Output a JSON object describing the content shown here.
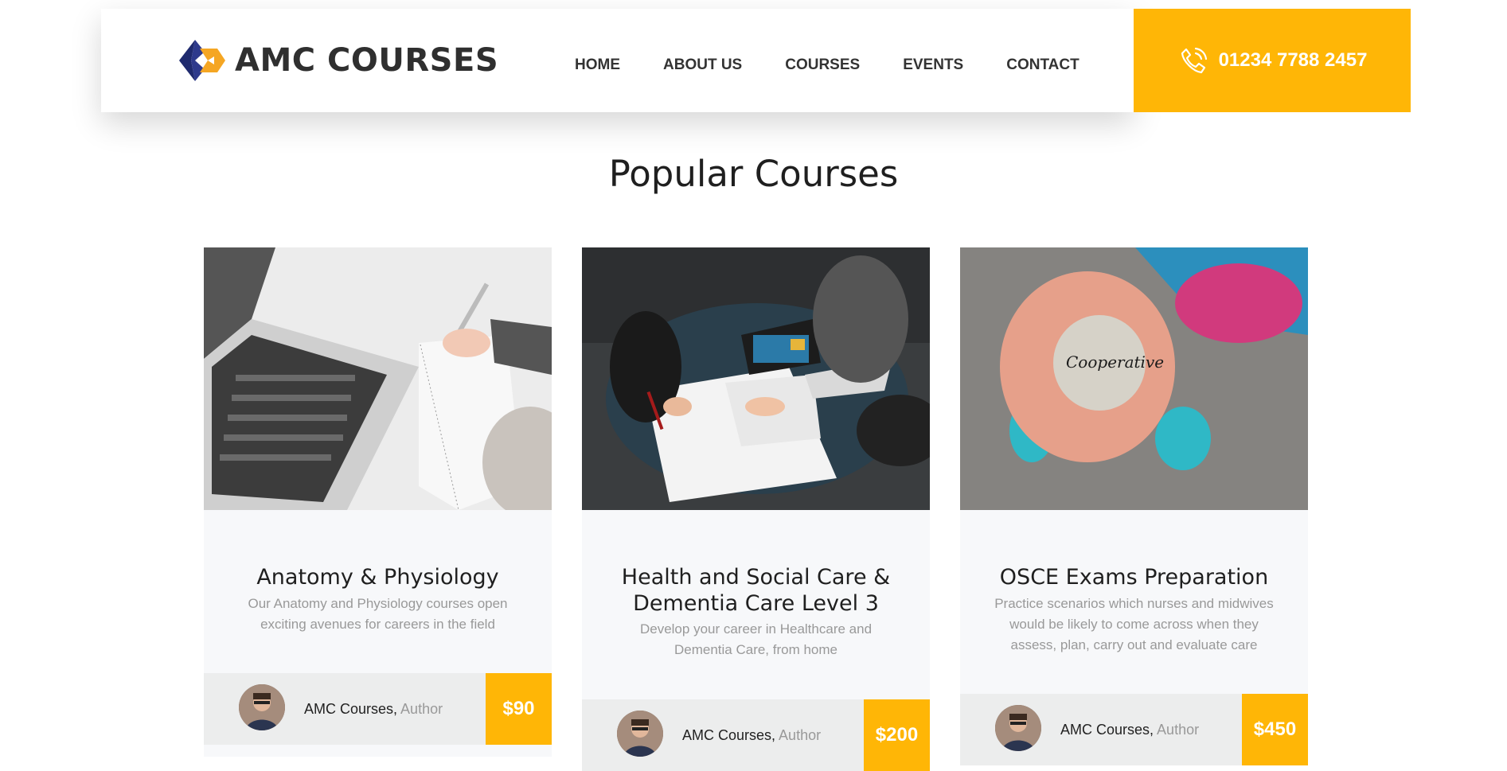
{
  "header": {
    "logo_text": "AMC COURSES",
    "nav": [
      "HOME",
      "ABOUT US",
      "COURSES",
      "EVENTS",
      "CONTACT"
    ],
    "phone": "01234 7788 2457"
  },
  "section": {
    "title": "Popular Courses"
  },
  "courses": [
    {
      "title": "Anatomy & Physiology",
      "description": "Our Anatomy and Physiology courses open exciting avenues for careers in the field",
      "author": "AMC Courses,",
      "author_role": "Author",
      "price": "$90",
      "image_icon": "laptop-notebook-photo"
    },
    {
      "title": "Health and Social Care & Dementia Care Level 3",
      "description": "Develop your career in Healthcare and Dementia Care, from home",
      "author": "AMC Courses,",
      "author_role": "Author",
      "price": "$200",
      "image_icon": "team-meeting-photo"
    },
    {
      "title": "OSCE Exams Preparation",
      "description": "Practice scenarios which nurses and midwives would be likely to come across when they assess, plan, carry out and evaluate care",
      "author": "AMC Courses,",
      "author_role": "Author",
      "price": "$450",
      "image_icon": "cooperative-stone-photo",
      "image_text": "Cooperative"
    }
  ],
  "colors": {
    "accent": "#ffb606",
    "logo_blue": "#1f2a6e",
    "logo_orange": "#f5a623"
  }
}
